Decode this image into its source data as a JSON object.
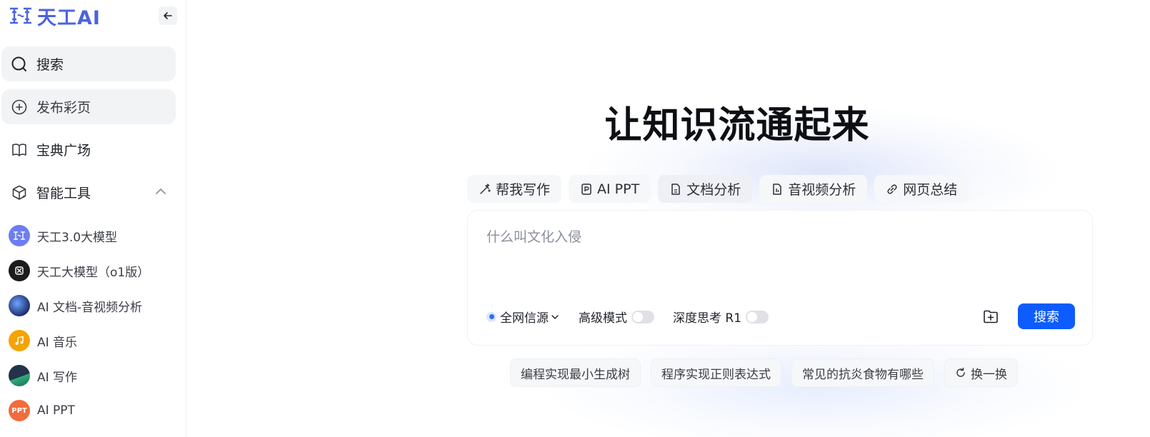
{
  "brand": {
    "name": "天工AI",
    "accent": "#4b63e0"
  },
  "sidebar": {
    "collapse_icon": "arrow-left-icon",
    "nav": [
      {
        "label": "搜索",
        "icon": "search-icon"
      },
      {
        "label": "发布彩页",
        "icon": "plus-circle-icon"
      },
      {
        "label": "宝典广场",
        "icon": "book-icon"
      },
      {
        "label": "智能工具",
        "icon": "cube-icon",
        "expanded": true
      }
    ],
    "tools": [
      {
        "label": "天工3.0大模型",
        "avatar": "tiangong-logo",
        "color": "#5b6ef0"
      },
      {
        "label": "天工大模型（o1版）",
        "avatar": "o1-logo",
        "color": "#1c1c1c"
      },
      {
        "label": "AI 文档-音视频分析",
        "avatar": "doc-av-avatar",
        "color": "#1d2f6b"
      },
      {
        "label": "AI 音乐",
        "avatar": "music-note-icon",
        "color": "#f5a300"
      },
      {
        "label": "AI 写作",
        "avatar": "writing-avatar",
        "color": "#22334a"
      },
      {
        "label": "AI PPT",
        "avatar": "PPT",
        "color": "#f26b3a"
      }
    ]
  },
  "main": {
    "headline": "让知识流通起来",
    "chips": [
      {
        "label": "帮我写作",
        "icon": "magic-pen-icon"
      },
      {
        "label": "AI PPT",
        "icon": "ppt-doc-icon"
      },
      {
        "label": "文档分析",
        "icon": "document-icon"
      },
      {
        "label": "音视频分析",
        "icon": "media-file-icon"
      },
      {
        "label": "网页总结",
        "icon": "link-icon"
      }
    ],
    "search": {
      "placeholder": "什么叫文化入侵",
      "source_label": "全网信源",
      "advanced_label": "高级模式",
      "advanced_on": false,
      "deep_think_label": "深度思考 R1",
      "deep_think_on": false,
      "upload_icon": "folder-plus-icon",
      "submit_label": "搜索",
      "submit_color": "#0c5cff"
    },
    "suggestions": [
      "编程实现最小生成树",
      "程序实现正则表达式",
      "常见的抗炎食物有哪些"
    ],
    "refresh_label": "换一换"
  }
}
